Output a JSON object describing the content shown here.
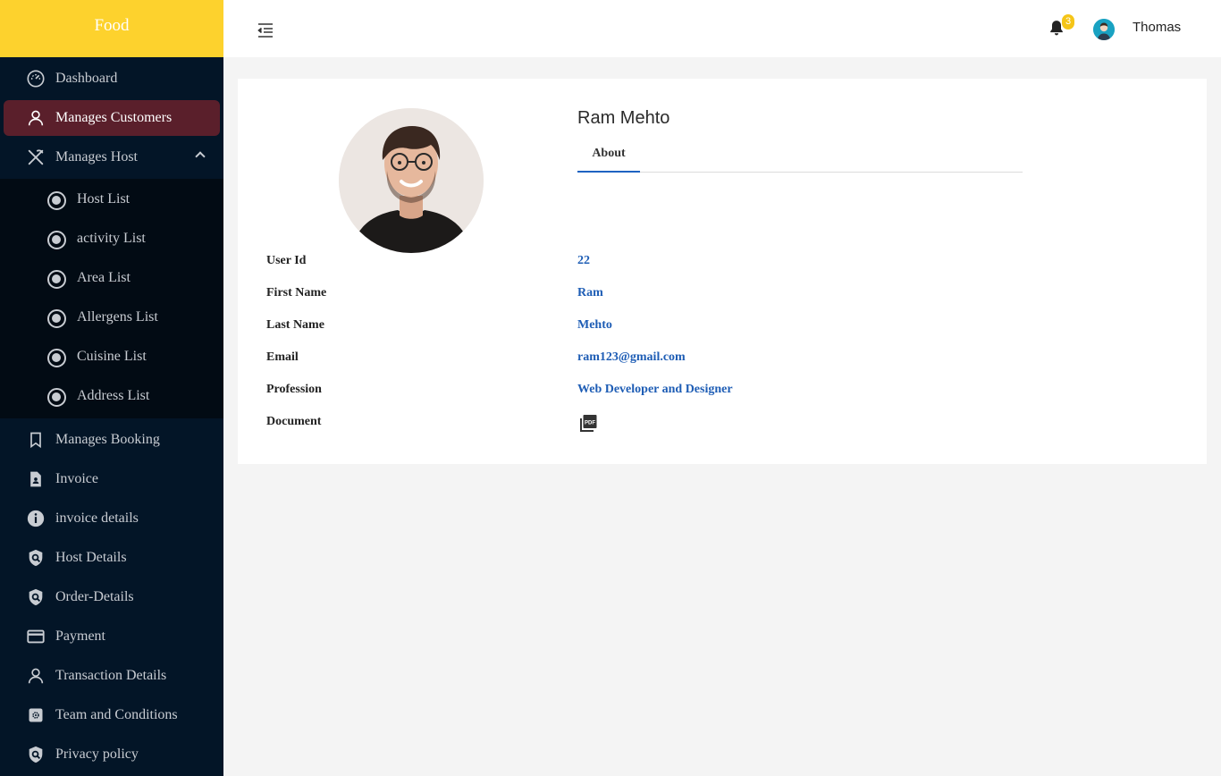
{
  "brand": "Food",
  "sidebar": {
    "items": [
      {
        "label": "Dashboard",
        "icon": "dashboard-gauge-icon"
      },
      {
        "label": "Manages Customers",
        "icon": "user-icon",
        "active": true
      },
      {
        "label": "Manages Host",
        "icon": "fork-knife-icon",
        "expanded": true
      },
      {
        "label": "Manages Booking",
        "icon": "bookmark-icon"
      },
      {
        "label": "Invoice",
        "icon": "document-user-icon"
      },
      {
        "label": "invoice details",
        "icon": "info-icon"
      },
      {
        "label": "Host Details",
        "icon": "shield-search-icon"
      },
      {
        "label": "Order-Details",
        "icon": "shield-search-icon"
      },
      {
        "label": "Payment",
        "icon": "credit-card-icon"
      },
      {
        "label": "Transaction Details",
        "icon": "user-icon"
      },
      {
        "label": "Team and Conditions",
        "icon": "settings-icon"
      },
      {
        "label": "Privacy policy",
        "icon": "shield-search-icon"
      }
    ],
    "submenu": [
      {
        "label": "Host List",
        "icon": "radio-icon"
      },
      {
        "label": "activity List",
        "icon": "radio-icon"
      },
      {
        "label": "Area List",
        "icon": "radio-icon"
      },
      {
        "label": "Allergens List",
        "icon": "radio-icon"
      },
      {
        "label": "Cuisine List",
        "icon": "radio-icon"
      },
      {
        "label": "Address List",
        "icon": "radio-icon"
      }
    ]
  },
  "header": {
    "notification_count": "3",
    "user_name": "Thomas"
  },
  "profile": {
    "name": "Ram Mehto",
    "tabs": [
      "About"
    ],
    "fields": [
      {
        "label": "User Id",
        "value": "22"
      },
      {
        "label": "First Name",
        "value": "Ram"
      },
      {
        "label": "Last Name",
        "value": "Mehto"
      },
      {
        "label": "Email",
        "value": "ram123@gmail.com"
      },
      {
        "label": "Profession",
        "value": "Web Developer and Designer"
      },
      {
        "label": "Document",
        "value": "",
        "icon": "pdf-icon"
      }
    ]
  },
  "colors": {
    "brand_yellow": "#fdd22d",
    "sidebar_bg": "#031527",
    "active_item_bg": "#5a1f2b",
    "link_blue": "#1e5db5"
  }
}
